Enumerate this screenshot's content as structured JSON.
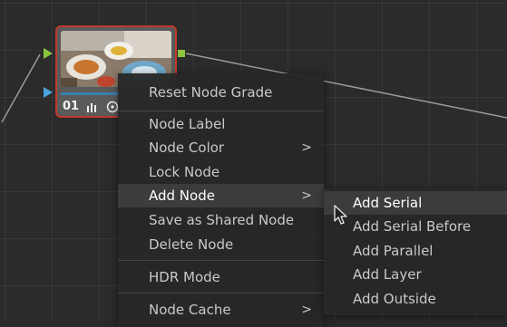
{
  "node": {
    "number": "01",
    "icons": [
      "bars-icon",
      "circle-target-icon"
    ]
  },
  "context_menu": {
    "items": [
      {
        "label": "Reset Node Grade"
      },
      {
        "label": "Node Label"
      },
      {
        "label": "Node Color",
        "submenu": true
      },
      {
        "label": "Lock Node"
      },
      {
        "label": "Add Node",
        "submenu": true,
        "highlighted": true
      },
      {
        "label": "Save as Shared Node"
      },
      {
        "label": "Delete Node"
      },
      {
        "label": "HDR Mode"
      },
      {
        "label": "Node Cache",
        "submenu": true
      }
    ],
    "arrow_glyph": ">"
  },
  "submenu": {
    "items": [
      {
        "label": "Add Serial",
        "highlighted": true
      },
      {
        "label": "Add Serial Before"
      },
      {
        "label": "Add Parallel"
      },
      {
        "label": "Add Layer"
      },
      {
        "label": "Add Outside"
      }
    ]
  },
  "colors": {
    "node_border_selected": "#c0392b",
    "input_green": "#8cc63f",
    "input_blue": "#4aa3df",
    "menu_bg": "#282828",
    "menu_highlight": "#3c3c3c"
  }
}
